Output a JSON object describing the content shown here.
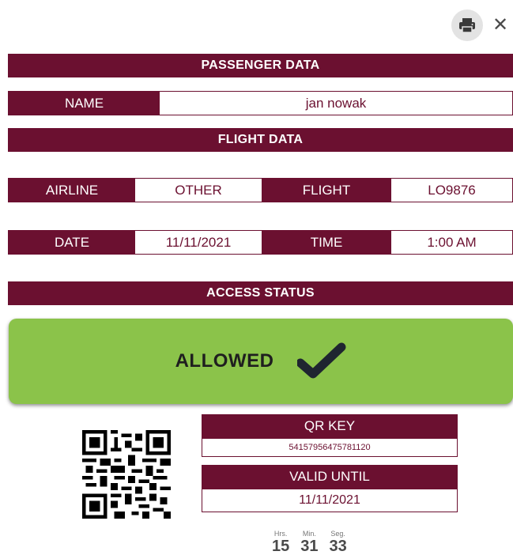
{
  "controls": {
    "print_icon": "printer-icon",
    "close_icon": "close-icon",
    "close_glyph": "✕"
  },
  "passenger_section": {
    "title": "PASSENGER DATA",
    "name_label": "NAME",
    "name_value": "jan nowak"
  },
  "flight_section": {
    "title": "FLIGHT DATA",
    "airline_label": "AIRLINE",
    "airline_value": "OTHER",
    "flight_label": "FLIGHT",
    "flight_value": "LO9876",
    "date_label": "DATE",
    "date_value": "11/11/2021",
    "time_label": "TIME",
    "time_value": "1:00 AM"
  },
  "access_section": {
    "title": "ACCESS STATUS",
    "status": "ALLOWED",
    "status_icon": "checkmark-icon",
    "status_color": "#8bc34a"
  },
  "qr": {
    "key_label": "QR KEY",
    "key_value": "54157956475781120",
    "valid_label": "VALID UNTIL",
    "valid_value": "11/11/2021"
  },
  "countdown": {
    "hours_label": "Hrs.",
    "hours_value": "15",
    "minutes_label": "Min.",
    "minutes_value": "31",
    "seconds_label": "Seg.",
    "seconds_value": "33"
  },
  "colors": {
    "brand": "#6b1030",
    "success": "#8bc34a"
  }
}
